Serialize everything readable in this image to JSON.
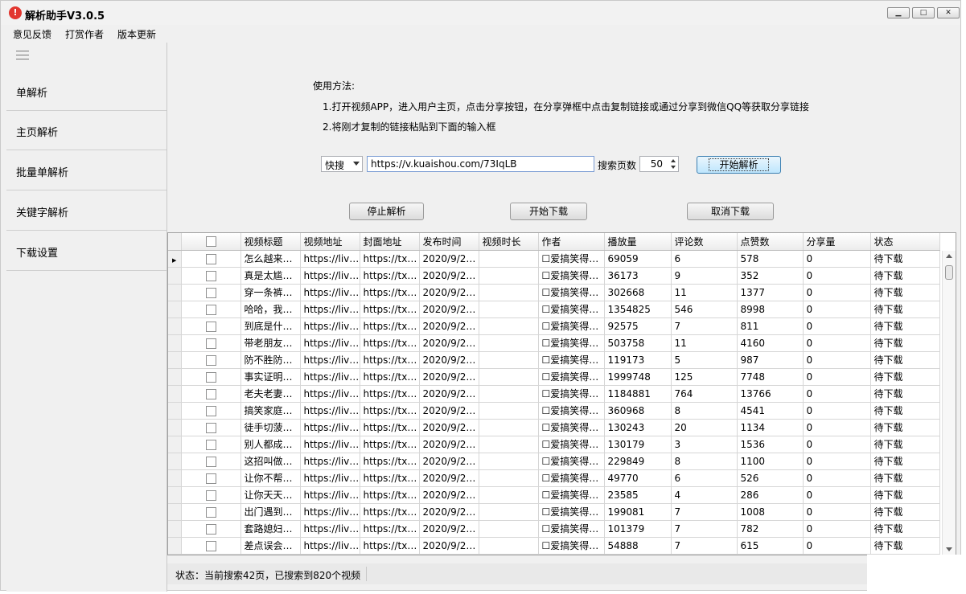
{
  "window": {
    "title": "解析助手V3.0.5",
    "icon_glyph": "!"
  },
  "menu": [
    "意见反馈",
    "打赏作者",
    "版本更新"
  ],
  "sidebar": {
    "items": [
      "单解析",
      "主页解析",
      "批量单解析",
      "关键字解析",
      "下载设置"
    ]
  },
  "instructions": {
    "heading": "使用方法:",
    "step1": "1.打开视频APP，进入用户主页，点击分享按钮，在分享弹框中点击复制链接或通过分享到微信QQ等获取分享链接",
    "step2": "2.将刚才复制的链接粘贴到下面的输入框"
  },
  "search": {
    "platform": "快搜",
    "url": "https://v.kuaishou.com/73IqLB",
    "pages_label": "搜索页数",
    "pages_value": "50",
    "start_parse": "开始解析"
  },
  "actions": {
    "stop_parse": "停止解析",
    "start_download": "开始下载",
    "cancel_download": "取消下载"
  },
  "table": {
    "headers": [
      "视频标题",
      "视频地址",
      "封面地址",
      "发布时间",
      "视频时长",
      "作者",
      "播放量",
      "评论数",
      "点赞数",
      "分享量",
      "状态"
    ],
    "rows": [
      [
        "怎么越来…",
        "https://liv…",
        "https://tx…",
        "2020/9/2…",
        "",
        "☐爱搞笑得…",
        "69059",
        "6",
        "578",
        "0",
        "待下载"
      ],
      [
        "真是太尴…",
        "https://liv…",
        "https://tx…",
        "2020/9/2…",
        "",
        "☐爱搞笑得…",
        "36173",
        "9",
        "352",
        "0",
        "待下载"
      ],
      [
        "穿一条裤…",
        "https://liv…",
        "https://tx…",
        "2020/9/2…",
        "",
        "☐爱搞笑得…",
        "302668",
        "11",
        "1377",
        "0",
        "待下载"
      ],
      [
        "哈哈，我…",
        "https://liv…",
        "https://tx…",
        "2020/9/2…",
        "",
        "☐爱搞笑得…",
        "1354825",
        "546",
        "8998",
        "0",
        "待下载"
      ],
      [
        "到底是什…",
        "https://liv…",
        "https://tx…",
        "2020/9/2…",
        "",
        "☐爱搞笑得…",
        "92575",
        "7",
        "811",
        "0",
        "待下载"
      ],
      [
        "带老朋友…",
        "https://liv…",
        "https://tx…",
        "2020/9/2…",
        "",
        "☐爱搞笑得…",
        "503758",
        "11",
        "4160",
        "0",
        "待下载"
      ],
      [
        "防不胜防…",
        "https://liv…",
        "https://tx…",
        "2020/9/2…",
        "",
        "☐爱搞笑得…",
        "119173",
        "5",
        "987",
        "0",
        "待下载"
      ],
      [
        "事实证明…",
        "https://liv…",
        "https://tx…",
        "2020/9/2…",
        "",
        "☐爱搞笑得…",
        "1999748",
        "125",
        "7748",
        "0",
        "待下载"
      ],
      [
        "老夫老妻…",
        "https://liv…",
        "https://tx…",
        "2020/9/2…",
        "",
        "☐爱搞笑得…",
        "1184881",
        "764",
        "13766",
        "0",
        "待下载"
      ],
      [
        "搞笑家庭…",
        "https://liv…",
        "https://tx…",
        "2020/9/2…",
        "",
        "☐爱搞笑得…",
        "360968",
        "8",
        "4541",
        "0",
        "待下载"
      ],
      [
        "徒手切菠…",
        "https://liv…",
        "https://tx…",
        "2020/9/2…",
        "",
        "☐爱搞笑得…",
        "130243",
        "20",
        "1134",
        "0",
        "待下载"
      ],
      [
        "别人都成…",
        "https://liv…",
        "https://tx…",
        "2020/9/2…",
        "",
        "☐爱搞笑得…",
        "130179",
        "3",
        "1536",
        "0",
        "待下载"
      ],
      [
        "这招叫做…",
        "https://liv…",
        "https://tx…",
        "2020/9/2…",
        "",
        "☐爱搞笑得…",
        "229849",
        "8",
        "1100",
        "0",
        "待下载"
      ],
      [
        "让你不帮…",
        "https://liv…",
        "https://tx…",
        "2020/9/2…",
        "",
        "☐爱搞笑得…",
        "49770",
        "6",
        "526",
        "0",
        "待下载"
      ],
      [
        "让你天天…",
        "https://liv…",
        "https://tx…",
        "2020/9/2…",
        "",
        "☐爱搞笑得…",
        "23585",
        "4",
        "286",
        "0",
        "待下载"
      ],
      [
        "出门遇到…",
        "https://liv…",
        "https://tx…",
        "2020/9/2…",
        "",
        "☐爱搞笑得…",
        "199081",
        "7",
        "1008",
        "0",
        "待下载"
      ],
      [
        "套路媳妇…",
        "https://liv…",
        "https://tx…",
        "2020/9/2…",
        "",
        "☐爱搞笑得…",
        "101379",
        "7",
        "782",
        "0",
        "待下载"
      ],
      [
        "差点误会…",
        "https://liv…",
        "https://tx…",
        "2020/9/2…",
        "",
        "☐爱搞笑得…",
        "54888",
        "7",
        "615",
        "0",
        "待下载"
      ]
    ]
  },
  "status": {
    "text": "状态：当前搜索42页，已搜索到820个视频"
  }
}
